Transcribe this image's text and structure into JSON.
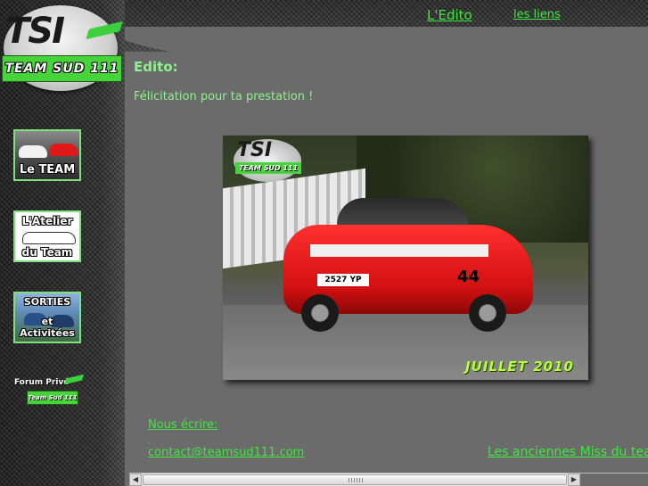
{
  "header": {
    "nav": {
      "edito": "L'Edito",
      "liens": "les liens"
    }
  },
  "logo": {
    "tsi": "TSI",
    "band": "TEAM SUD 111"
  },
  "sidebar": {
    "team": {
      "label": "Le TEAM"
    },
    "atelier": {
      "line1": "L'Atelier",
      "line2": "du Team"
    },
    "sorties": {
      "line1": "SORTIES",
      "line2": "et Activitées"
    },
    "forum": {
      "line1": "Forum Privé",
      "badge": "Team Sud 111"
    }
  },
  "main": {
    "title": "Edito:",
    "intro": "Félicitation pour ta prestation !",
    "photo": {
      "caption": "JUILLET 2010",
      "plate": "2527 YP",
      "number": "44",
      "logo_tsi": "TSI",
      "logo_band": "TEAM SUD 111"
    },
    "write_label": "Nous écrire:",
    "dot": ".",
    "contact": "contact@teamsud111.com",
    "miss_link": "Les anciennes Miss du team"
  },
  "colors": {
    "accent": "#3ee83e",
    "text_green": "#8ef28e",
    "background": "#6b6b6b",
    "caption": "#b7ff34"
  }
}
